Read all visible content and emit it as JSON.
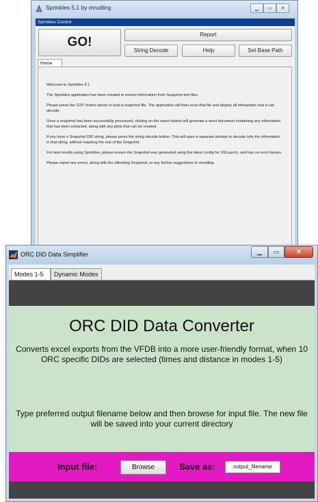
{
  "sprinkles": {
    "window_title": "Sprinkles 5.1 by mrudling",
    "panel_title": "Sprinkles Control",
    "go_label": "GO!",
    "report_label": "Report",
    "string_decode_label": "String Decode",
    "help_label": "Help",
    "set_base_path_label": "Set Base Path",
    "tab_home": "Home",
    "paragraphs": [
      "Welcome to Sprinkles 5.1",
      "The Sprinkles application has been created to extract information from Snapshot text files.",
      "Please press the 'GO!' button above to load a snapshot file. The application will then scan that file and display all inforamtion that it can decode.",
      "Once a snapshot has been successfully processed, clicking on the report button will generate a word document containing any information that has been extracted, along with any plots that can be created.",
      "If you have a Snapshot DID string, please press the string decode button. This will open a separate window to decode only the information in that string, without requiring the rest of the Snapshot.",
      "For best results using Sprinkles, please ensure the Snapshot was generated using the latest config for SSLaunch, and has no error frames.",
      "Please report any errors, along with the offending Snapshot, or any further suggestions to mrudling."
    ]
  },
  "orc": {
    "window_title": "ORC DID Data Simplifier",
    "tabs": [
      "Modes 1-5",
      "Dynamic Modes"
    ],
    "heading": "ORC DID Data Converter",
    "description": "Converts excel exports from the VFDB into a more user-friendly format, when 10 ORC specific DIDs are selected (times and distance in modes 1-5)",
    "instructions": "Type preferred output filename below and then browse for input file. The new file will be saved into your current directory",
    "input_file_label": "Input file:",
    "browse_label": "Browse",
    "save_as_label": "Save as:",
    "output_filename_value": "output_filename",
    "colors": {
      "green_panel": "#cbe3cb",
      "magenta_bar": "#e319c1",
      "dark_band": "#434343"
    }
  }
}
